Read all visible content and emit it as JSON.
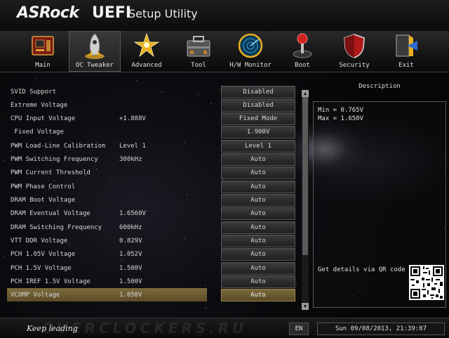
{
  "app": {
    "brand": "ASRock",
    "uefi": "UEFI",
    "subtitle": "Setup Utility"
  },
  "menu": [
    {
      "label": "Main",
      "icon": "motherboard-icon"
    },
    {
      "label": "OC Tweaker",
      "icon": "rocket-icon",
      "active": true
    },
    {
      "label": "Advanced",
      "icon": "star-burst-icon"
    },
    {
      "label": "Tool",
      "icon": "toolbox-icon"
    },
    {
      "label": "H/W Monitor",
      "icon": "radar-icon"
    },
    {
      "label": "Boot",
      "icon": "joystick-icon"
    },
    {
      "label": "Security",
      "icon": "shield-icon"
    },
    {
      "label": "Exit",
      "icon": "exit-door-icon"
    }
  ],
  "settings": [
    {
      "label": "SVID Support",
      "value": "",
      "option": "Disabled"
    },
    {
      "label": "Extreme Voltage",
      "value": "",
      "option": "Disabled"
    },
    {
      "label": "CPU Input Voltage",
      "value": "+1.888V",
      "option": "Fixed Mode"
    },
    {
      "label": " Fixed Voltage",
      "value": "",
      "option": "1.900V"
    },
    {
      "label": "PWM Load-Line Calibration",
      "value": "Level 1",
      "option": "Level 1"
    },
    {
      "label": "PWM Switching Frequency",
      "value": "300kHz",
      "option": "Auto"
    },
    {
      "label": "PWM Current Threshold",
      "value": "",
      "option": "Auto"
    },
    {
      "label": "PWM Phase Control",
      "value": "",
      "option": "Auto"
    },
    {
      "label": "DRAM Boot Voltage",
      "value": "",
      "option": "Auto"
    },
    {
      "label": "DRAM Eventual Voltage",
      "value": "1.6560V",
      "option": "Auto"
    },
    {
      "label": "DRAM Switching Frequency",
      "value": "600kHz",
      "option": "Auto"
    },
    {
      "label": "VTT DDR Voltage",
      "value": "0.829V",
      "option": "Auto"
    },
    {
      "label": "PCH 1.05V Voltage",
      "value": "1.052V",
      "option": "Auto"
    },
    {
      "label": "PCH 1.5V Voltage",
      "value": "1.500V",
      "option": "Auto"
    },
    {
      "label": "PCH IREF 1.5V Voltage",
      "value": "1.500V",
      "option": "Auto"
    },
    {
      "label": "VCOMP Voltage",
      "value": "1.050V",
      "option": "Auto",
      "selected": true
    }
  ],
  "scrollbar": {
    "up": "▲",
    "down": "▼"
  },
  "description": {
    "title": "Description",
    "lines": [
      "Min = 0.765V",
      "Max = 1.650V"
    ],
    "qr_text": "Get details via QR code"
  },
  "footer": {
    "slogan": "Keep leading",
    "watermark": "OVERCLOCKERS.RU",
    "language": "EN",
    "datetime": "Sun 09/08/2013, 21:39:07"
  },
  "colors": {
    "selection": "#6e5e34",
    "background": "#050507",
    "text": "#d8d8d8"
  }
}
